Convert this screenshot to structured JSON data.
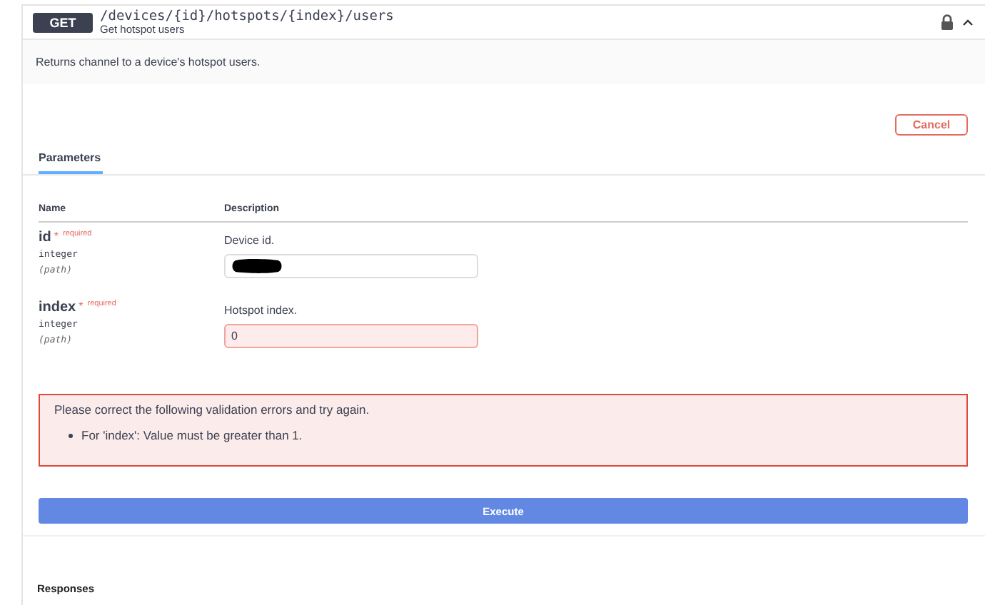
{
  "operation": {
    "method": "GET",
    "path": "/devices/{id}/hotspots/{index}/users",
    "summary": "Get hotspot users",
    "locked": true,
    "expanded": true
  },
  "description": "Returns channel to a device's hotspot users.",
  "cancel_button": "Cancel",
  "tabs": [
    {
      "label": "Parameters",
      "selected": true
    }
  ],
  "columns": [
    "Name",
    "Description"
  ],
  "parameters": [
    {
      "name": "id",
      "required_mark": "*",
      "required_label": "required",
      "type": "integer",
      "location": "(path)",
      "description": "Device id.",
      "value_redacted": true,
      "invalid": false
    },
    {
      "name": "index",
      "required_mark": "*",
      "required_label": "required",
      "type": "integer",
      "location": "(path)",
      "description": "Hotspot index.",
      "value": "0",
      "invalid": true
    }
  ],
  "error": {
    "message": "Please correct the following validation errors and try again.",
    "items": [
      "For 'index': Value must be greater than 1."
    ]
  },
  "execute_button": "Execute",
  "responses_heading": "Responses"
}
